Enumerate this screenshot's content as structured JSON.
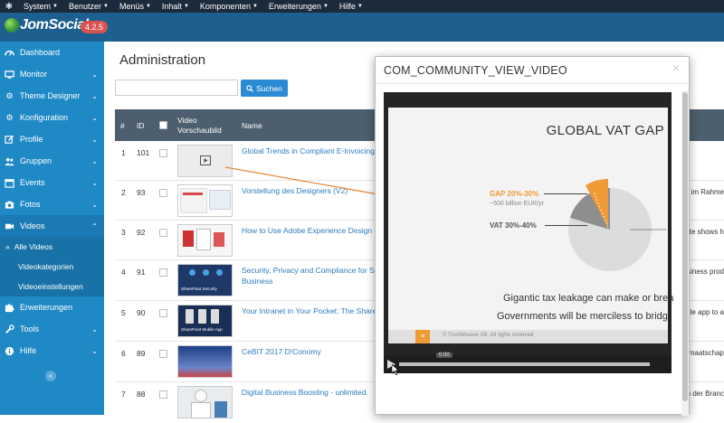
{
  "topmenu": {
    "items": [
      {
        "label": "System"
      },
      {
        "label": "Benutzer"
      },
      {
        "label": "Menüs"
      },
      {
        "label": "Inhalt"
      },
      {
        "label": "Komponenten"
      },
      {
        "label": "Erweiterungen"
      },
      {
        "label": "Hilfe"
      }
    ]
  },
  "brand": {
    "name": "JomSocial",
    "version": "4.2.5"
  },
  "sidebar": {
    "items": [
      {
        "label": "Dashboard",
        "icon": "dashboard-icon"
      },
      {
        "label": "Monitor",
        "icon": "monitor-icon"
      },
      {
        "label": "Theme Designer",
        "icon": "gears-icon"
      },
      {
        "label": "Konfiguration",
        "icon": "gears-icon"
      },
      {
        "label": "Profile",
        "icon": "edit-icon"
      },
      {
        "label": "Gruppen",
        "icon": "users-icon"
      },
      {
        "label": "Events",
        "icon": "calendar-icon"
      },
      {
        "label": "Fotos",
        "icon": "camera-icon"
      },
      {
        "label": "Videos",
        "icon": "video-icon"
      },
      {
        "label": "Erweiterungen",
        "icon": "puzzle-icon"
      },
      {
        "label": "Tools",
        "icon": "wrench-icon"
      },
      {
        "label": "Hilfe",
        "icon": "info-icon"
      }
    ],
    "videos_sub": [
      {
        "label": "Alle Videos",
        "marker": "»"
      },
      {
        "label": "Videokategorien"
      },
      {
        "label": "Videoeinstellungen"
      }
    ],
    "collapse": "«"
  },
  "main": {
    "title": "Administration",
    "search_placeholder": "",
    "search_button": "Suchen",
    "columns": {
      "hash": "#",
      "id": "ID",
      "thumb_line1": "Video",
      "thumb_line2": "Vorschaubild",
      "name": "Name"
    },
    "rows": [
      {
        "n": "1",
        "id": "101",
        "name": "Global Trends in Compliant E-Invoicing",
        "name2": "",
        "extra": ""
      },
      {
        "n": "2",
        "id": "93",
        "name": "Vorstellung des Designers (V2)",
        "name2": "",
        "extra": "im Rahme"
      },
      {
        "n": "3",
        "id": "92",
        "name": "How to Use Adobe Experience Design C",
        "name2": "",
        "extra": "ite shows h"
      },
      {
        "n": "4",
        "id": "91",
        "name": "Security, Privacy and Compliance for Sha",
        "name2": "Business",
        "extra": "usiness prod"
      },
      {
        "n": "5",
        "id": "90",
        "name": "Your Intranet in Your Pocket: The ShareP",
        "name2": "",
        "extra": "bile app to a"
      },
      {
        "n": "6",
        "id": "89",
        "name": "CeBIT 2017 D!Conomy",
        "name2": "",
        "extra": "maatschap"
      },
      {
        "n": "7",
        "id": "88",
        "name": "Digital Business Boosting - unlimited.",
        "name2": "",
        "extra": "n der Branc"
      }
    ],
    "thumb_captions": {
      "row4": "SharePoint Security",
      "row5": "SharePoint Mobile App"
    }
  },
  "modal": {
    "title": "COM_COMMUNITY_VIEW_VIDEO",
    "close": "×",
    "slide": {
      "heading": "GLOBAL VAT GAP",
      "gap_label": "GAP 20%-30%",
      "gap_sub": "~500 billion EUR/yr",
      "vat_label": "VAT 30%-40%",
      "line1": "Gigantic tax leakage can make or brea",
      "line2": "Governments will be merciless to bridg",
      "footer": "© TrustWeaver AB. All rights reserved",
      "footer_logo": "≡"
    },
    "player": {
      "time": "0:00"
    }
  },
  "colors": {
    "sidebar": "#1f89c6",
    "topbar": "#1c2b3c",
    "brandbar": "#1d5f8e",
    "accent_orange": "#f09a35"
  }
}
